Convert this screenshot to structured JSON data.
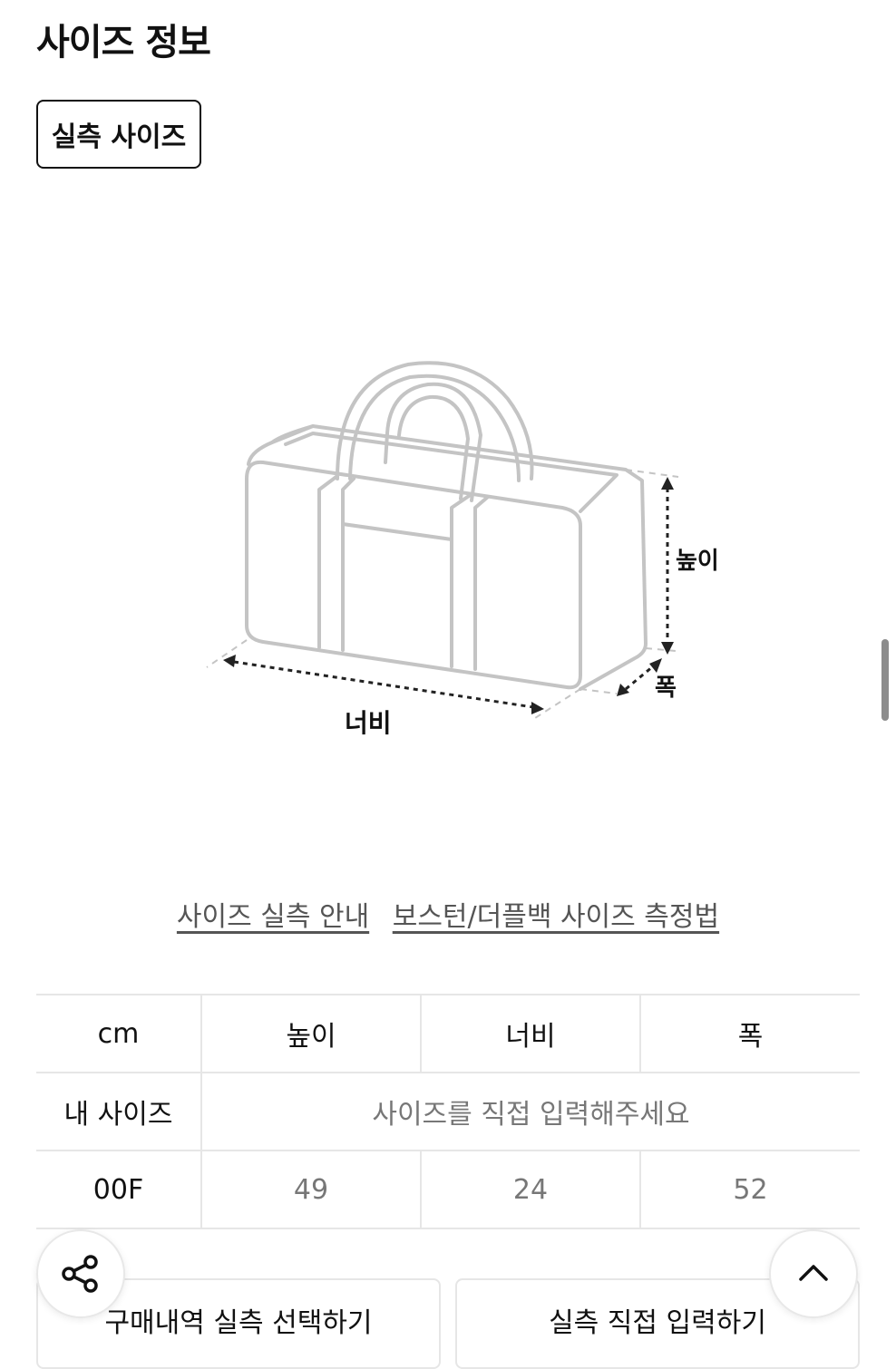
{
  "header": {
    "title": "사이즈 정보"
  },
  "tabs": [
    {
      "label": "실측 사이즈",
      "selected": true
    }
  ],
  "diagram": {
    "height_label": "높이",
    "width_label": "너비",
    "depth_label": "폭"
  },
  "guide_links": [
    "사이즈 실측 안내",
    "보스턴/더플백 사이즈 측정법"
  ],
  "size_table": {
    "headers": [
      "cm",
      "높이",
      "너비",
      "폭"
    ],
    "my_size": {
      "label": "내 사이즈",
      "placeholder": "사이즈를 직접 입력해주세요"
    },
    "rows": [
      {
        "size": "00F",
        "values": [
          "49",
          "24",
          "52"
        ]
      }
    ]
  },
  "actions": {
    "purchase_history_label": "구매내역 실측 선택하기",
    "direct_input_label": "실측 직접 입력하기"
  },
  "icons": {
    "share": "share-icon",
    "scroll_top": "chevron-up-icon"
  },
  "colors": {
    "text": "#111111",
    "muted": "#777777",
    "border": "#e6e6e6",
    "outline": "#bdbdbd"
  }
}
